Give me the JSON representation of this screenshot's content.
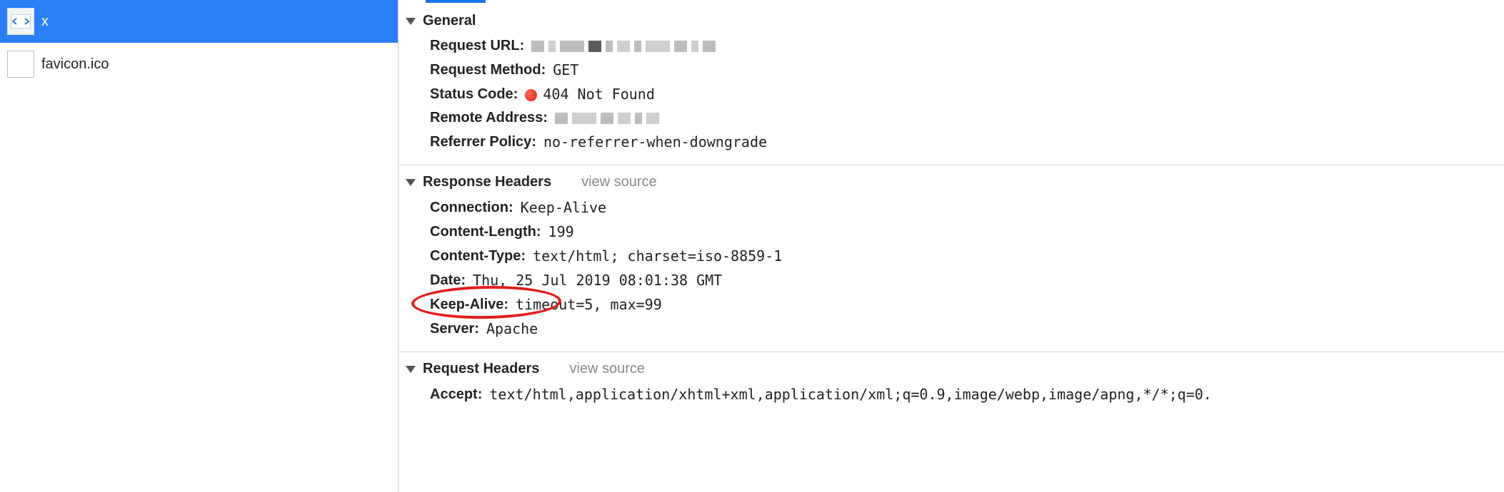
{
  "requests": [
    {
      "name": "x",
      "icon": "doc-code-icon",
      "selected": true
    },
    {
      "name": "favicon.ico",
      "icon": "blank-icon",
      "selected": false
    }
  ],
  "sections": {
    "general": {
      "title": "General",
      "items": {
        "request_url_label": "Request URL",
        "request_url_value_redacted": true,
        "request_method_label": "Request Method",
        "request_method_value": "GET",
        "status_code_label": "Status Code",
        "status_code_value": "404 Not Found",
        "status_color": "#d62012",
        "remote_address_label": "Remote Address",
        "remote_address_value_redacted": true,
        "referrer_policy_label": "Referrer Policy",
        "referrer_policy_value": "no-referrer-when-downgrade"
      }
    },
    "response_headers": {
      "title": "Response Headers",
      "view_source": "view source",
      "items": {
        "connection_label": "Connection",
        "connection_value": "Keep-Alive",
        "content_length_label": "Content-Length",
        "content_length_value": "199",
        "content_type_label": "Content-Type",
        "content_type_value": "text/html; charset=iso-8859-1",
        "date_label": "Date",
        "date_value": "Thu, 25 Jul 2019 08:01:38 GMT",
        "keep_alive_label": "Keep-Alive",
        "keep_alive_value": "timeout=5, max=99",
        "server_label": "Server",
        "server_value": "Apache"
      }
    },
    "request_headers": {
      "title": "Request Headers",
      "view_source": "view source",
      "items": {
        "accept_label": "Accept",
        "accept_value": "text/html,application/xhtml+xml,application/xml;q=0.9,image/webp,image/apng,*/*;q=0."
      }
    }
  }
}
